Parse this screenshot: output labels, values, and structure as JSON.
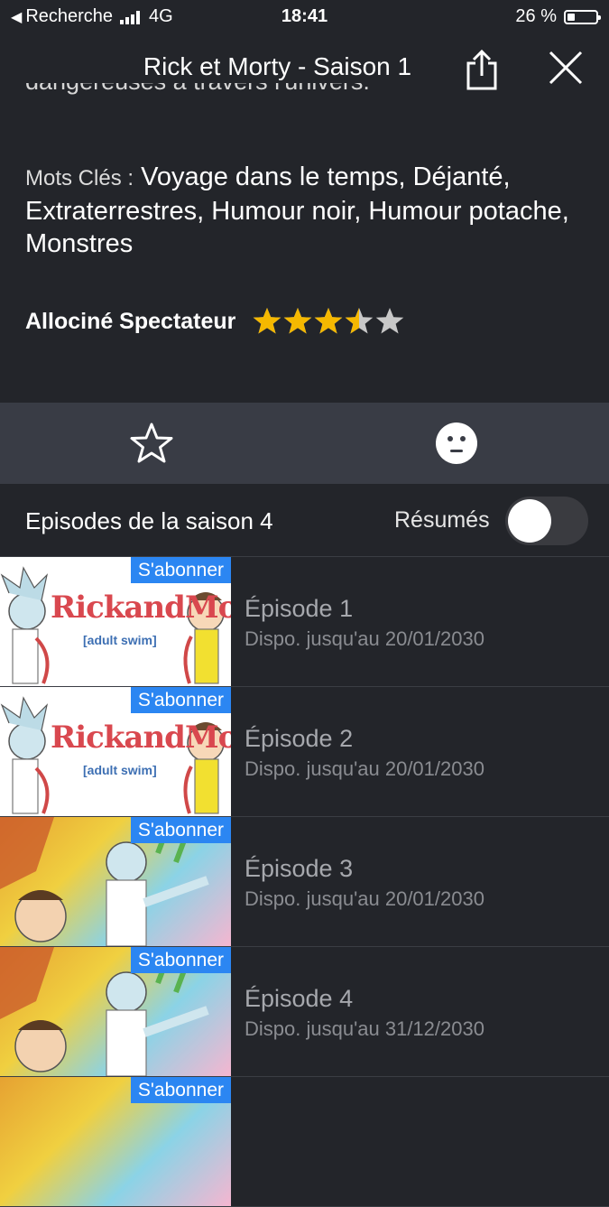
{
  "status_bar": {
    "back_label": "Recherche",
    "network": "4G",
    "time": "18:41",
    "battery_text": "26 %",
    "battery_level": 0.26
  },
  "header": {
    "title": "Rick et Morty - Saison 1",
    "share_icon": "share-icon",
    "close_icon": "close-icon"
  },
  "description_tail": "dangereuses à travers l'univers.",
  "keywords": {
    "label": "Mots Clés :",
    "value": "Voyage dans le temps, Déjanté, Extraterrestres, Humour noir, Humour potache, Monstres"
  },
  "rating": {
    "label": "Allociné Spectateur",
    "value": 3.5,
    "max": 5,
    "star_color": "#f5b800",
    "empty_star_color": "#c8c8c8"
  },
  "actions": {
    "favorite_icon": "star-outline-icon",
    "reaction_icon": "neutral-face-icon"
  },
  "episodes_section": {
    "title": "Episodes de la saison 4",
    "summaries_label": "Résumés",
    "summaries_on": false
  },
  "episodes": [
    {
      "title": "Épisode 1",
      "availability": "Dispo. jusqu'au 20/01/2030",
      "badge": "S'abonner",
      "thumb_logo": "RickandMorty",
      "thumb_sub": "[adult swim]"
    },
    {
      "title": "Épisode 2",
      "availability": "Dispo. jusqu'au 20/01/2030",
      "badge": "S'abonner",
      "thumb_logo": "RickandMorty",
      "thumb_sub": "[adult swim]"
    },
    {
      "title": "Épisode 3",
      "availability": "Dispo. jusqu'au 20/01/2030",
      "badge": "S'abonner"
    },
    {
      "title": "Épisode 4",
      "availability": "Dispo. jusqu'au 31/12/2030",
      "badge": "S'abonner"
    },
    {
      "badge": "S'abonner"
    }
  ],
  "colors": {
    "background": "#23252a",
    "action_bar": "#393c45",
    "badge": "#2b86f2"
  }
}
